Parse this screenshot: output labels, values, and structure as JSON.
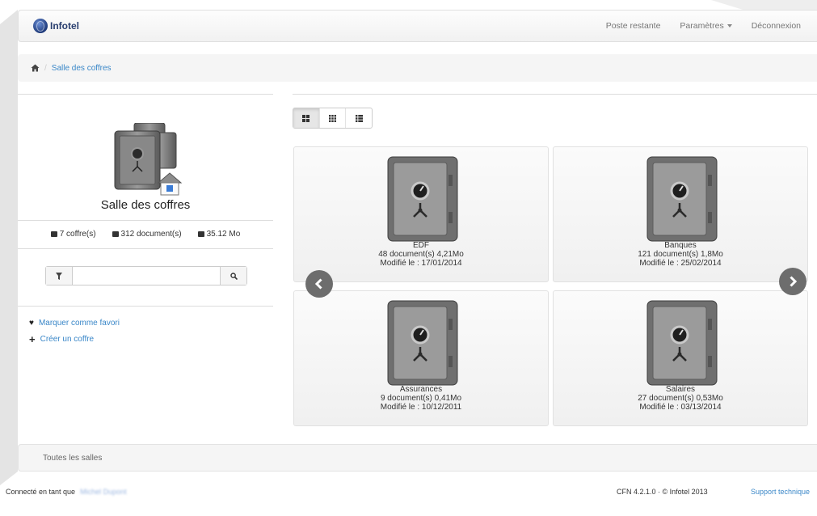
{
  "navbar": {
    "brand": "Infotel",
    "links": [
      "Poste restante",
      "Paramètres",
      "Déconnexion"
    ]
  },
  "breadcrumb": {
    "current": "Salle des coffres"
  },
  "left": {
    "title": "Salle des coffres",
    "stats": {
      "coffres": "7 coffre(s)",
      "documents": "312 document(s)",
      "size": "35.12 Mo"
    },
    "search": {
      "value": "",
      "placeholder": ""
    },
    "actions": [
      "Marquer comme favori",
      "Créer un coffre"
    ]
  },
  "safes": [
    {
      "name": "EDF",
      "docs": "48 document(s) 4,21Mo",
      "modified": "Modifié le : 17/01/2014"
    },
    {
      "name": "Banques",
      "docs": "121 document(s) 1,8Mo",
      "modified": "Modifié le : 25/02/2014"
    },
    {
      "name": "Assurances",
      "docs": "9 document(s) 0,41Mo",
      "modified": "Modifié le : 10/12/2011"
    },
    {
      "name": "Salaires",
      "docs": "27 document(s) 0,53Mo",
      "modified": "Modifié le : 03/13/2014"
    }
  ],
  "bottom": {
    "all_rooms": "Toutes les salles"
  },
  "footer": {
    "connected": "Connecté en tant que",
    "user": "Michel Dupont",
    "version": "CFN 4.2.1.0 · © Infotel 2013",
    "support": "Support technique"
  },
  "colors": {
    "link": "#3a87c8",
    "brand": "#2a3f6f"
  }
}
